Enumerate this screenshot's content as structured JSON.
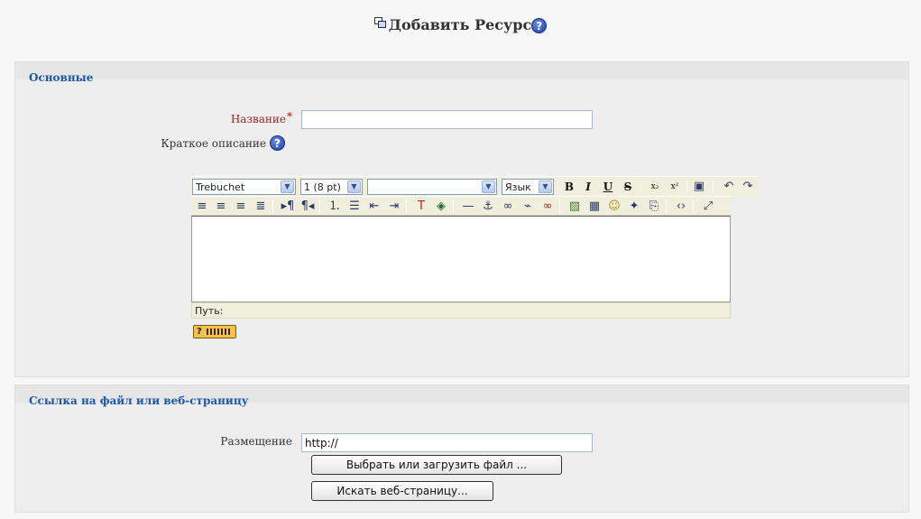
{
  "page": {
    "title": "Добавить Ресурс",
    "help_glyph": "?",
    "title_icon": "resource-icon"
  },
  "general": {
    "legend": "Основные",
    "name_label": "Название",
    "required_mark": "*",
    "name_value": "",
    "summary_label": "Краткое описание",
    "help_glyph": "?"
  },
  "editor": {
    "font_family": "Trebuchet",
    "font_size": "1 (8 pt)",
    "format": "",
    "language": "Язык",
    "buttons": {
      "bold": "B",
      "italic": "I",
      "underline": "U",
      "strike": "S"
    },
    "path_label": "Путь:",
    "content": ""
  },
  "link_section": {
    "legend": "Ссылка на файл или веб-страницу",
    "location_label": "Размещение",
    "location_value": "http://",
    "choose_button": "Выбрать или загрузить файл ...",
    "search_button": "Искать веб-страницу..."
  },
  "colors": {
    "legend": "#1d57a6",
    "required": "#a32222",
    "toolbar_bg": "#f0eedd",
    "fieldset_bg": "#eeeeee"
  }
}
